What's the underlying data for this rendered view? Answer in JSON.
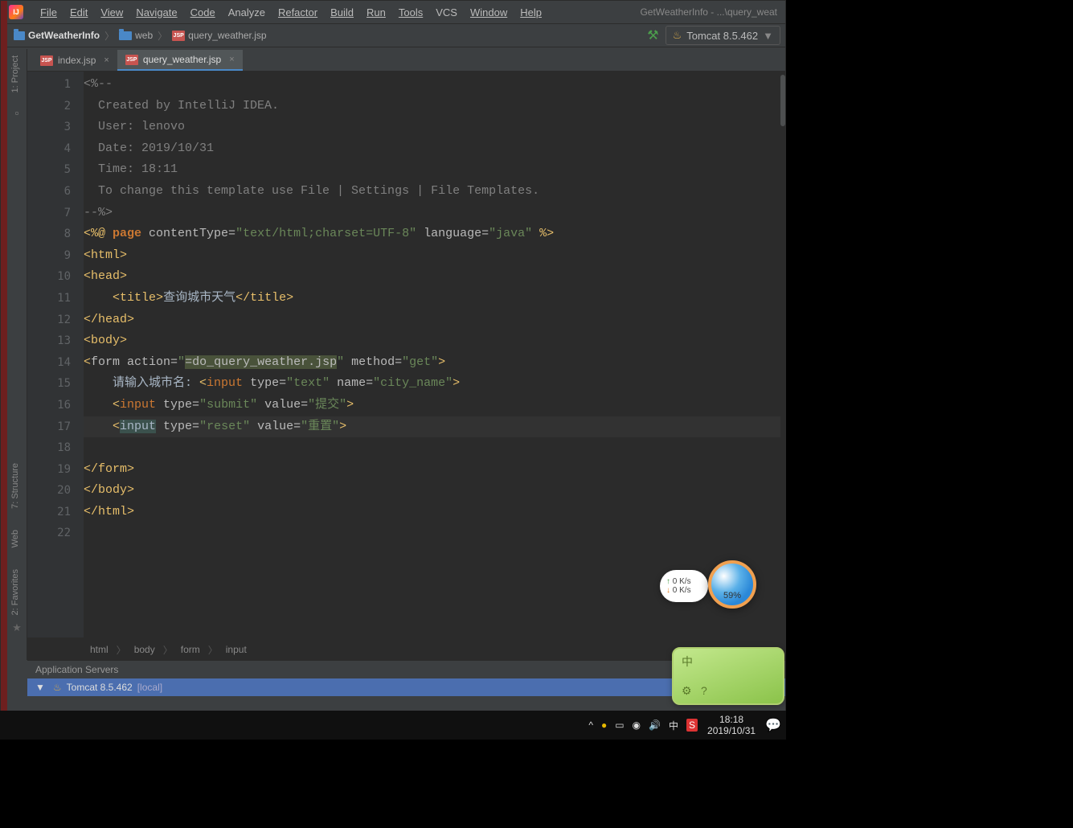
{
  "window": {
    "title_right": "GetWeatherInfo - ...\\query_weat",
    "app_badge": "IJ"
  },
  "menu": [
    "File",
    "Edit",
    "View",
    "Navigate",
    "Code",
    "Analyze",
    "Refactor",
    "Build",
    "Run",
    "Tools",
    "VCS",
    "Window",
    "Help"
  ],
  "menu_underline_idx": [
    0,
    0,
    0,
    0,
    0,
    -1,
    0,
    0,
    1,
    0,
    -1,
    0,
    0
  ],
  "breadcrumb": {
    "items": [
      "GetWeatherInfo",
      "web",
      "query_weather.jsp"
    ]
  },
  "run_config": "Tomcat 8.5.462",
  "tabs": [
    {
      "label": "index.jsp",
      "active": false
    },
    {
      "label": "query_weather.jsp",
      "active": true
    }
  ],
  "left_tools": [
    "1: Project",
    "7: Structure",
    "Web",
    "2: Favorites"
  ],
  "gutter_lines": [
    "1",
    "2",
    "3",
    "4",
    "5",
    "6",
    "7",
    "8",
    "9",
    "10",
    "11",
    "12",
    "13",
    "14",
    "15",
    "16",
    "17",
    "18",
    "19",
    "20",
    "21",
    "22"
  ],
  "code_crumbs": [
    "html",
    "body",
    "form",
    "input"
  ],
  "code": {
    "l1_a": "<%--",
    "l2_a": "  Created by IntelliJ IDEA.",
    "l3_a": "  User: lenovo",
    "l4_a": "  Date: 2019/10/31",
    "l5_a": "  Time: 18:11",
    "l6_a": "  To change this template use File | Settings | File Templates.",
    "l7_a": "--%>",
    "l8_pre": "<%@ ",
    "l8_kw": "page",
    "l8_a": " contentType=",
    "l8_s1": "\"text/html;charset=UTF-8\"",
    "l8_b": " language=",
    "l8_s2": "\"java\"",
    "l8_end": " %>",
    "l9": "html",
    "l10": "head",
    "l11_a": "title",
    "l11_txt": "查询城市天气",
    "l12": "head",
    "l13": "body",
    "l14_a": "form action=",
    "l14_s": "\"",
    "l14_hl": "=do_query_weather.jsp",
    "l14_s2": "\"",
    "l14_b": " method=",
    "l14_s3": "\"get\"",
    "l15_txt": "请输入城市名: ",
    "l15_in": "input",
    "l15_a": " type=",
    "l15_s1": "\"text\"",
    "l15_b": " name=",
    "l15_s2": "\"city_name\"",
    "l16_in": "input",
    "l16_a": " type=",
    "l16_s1": "\"submit\"",
    "l16_b": " value=",
    "l16_s2": "\"提交\"",
    "l17_in": "input",
    "l17_a": " type=",
    "l17_s1": "\"reset\"",
    "l17_b": " value=",
    "l17_s2": "\"重置\"",
    "l19": "form",
    "l20": "body",
    "l21": "html"
  },
  "bottom_panel": {
    "title": "Application Servers",
    "row": "Tomcat 8.5.462 ",
    "row_suffix": "[local]"
  },
  "net": {
    "up": "0  K/s",
    "down": "0  K/s"
  },
  "circle": "59%",
  "green_icons": {
    "a": "中",
    "b": "⚙",
    "c": "?"
  },
  "taskbar": {
    "tray": [
      "^",
      "●",
      "▭",
      "◉",
      "🔊",
      "中",
      "S"
    ],
    "time": "18:18",
    "date": "2019/10/31"
  }
}
